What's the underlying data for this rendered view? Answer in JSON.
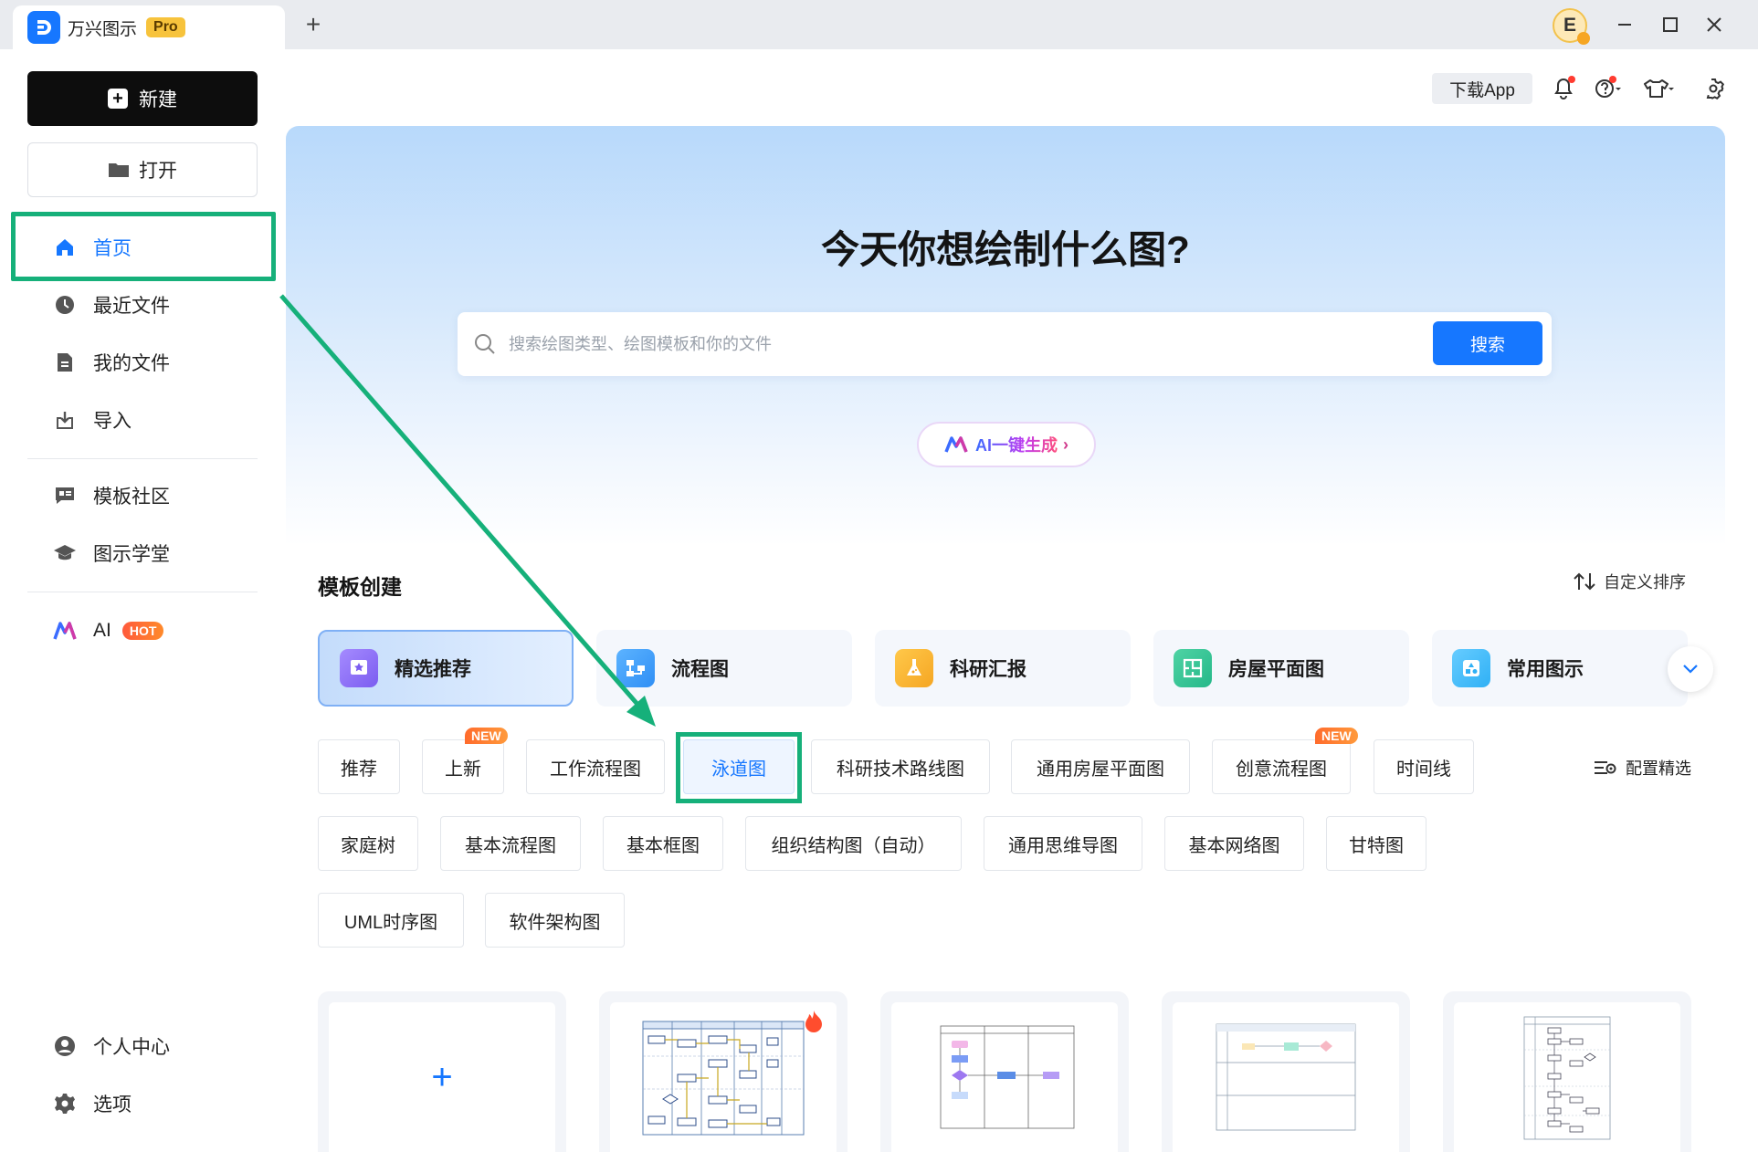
{
  "titlebar": {
    "app_name": "万兴图示",
    "pro_badge": "Pro",
    "new_tab": "+",
    "user_initial": "E"
  },
  "sidebar": {
    "new_label": "新建",
    "open_label": "打开",
    "items": [
      {
        "label": "首页",
        "icon": "home-icon",
        "active": true
      },
      {
        "label": "最近文件",
        "icon": "clock-icon"
      },
      {
        "label": "我的文件",
        "icon": "file-icon"
      },
      {
        "label": "导入",
        "icon": "import-icon"
      },
      {
        "label": "模板社区",
        "icon": "community-icon"
      },
      {
        "label": "图示学堂",
        "icon": "graduation-cap-icon"
      },
      {
        "label": "AI",
        "icon": "ai-logo-icon",
        "badge": "HOT"
      },
      {
        "label": "个人中心",
        "icon": "user-icon"
      },
      {
        "label": "选项",
        "icon": "gear-icon"
      }
    ]
  },
  "toolbar": {
    "download_app": "下载App"
  },
  "hero": {
    "title": "今天你想绘制什么图?",
    "search_placeholder": "搜索绘图类型、绘图模板和你的文件",
    "search_button": "搜索",
    "ai_button": "AI一键生成",
    "ai_chevron": "›"
  },
  "templates": {
    "section_title": "模板创建",
    "sort_label": "自定义排序",
    "config_label": "配置精选",
    "categories": [
      {
        "label": "精选推荐",
        "color": "#8b6cf0",
        "selected": true
      },
      {
        "label": "流程图",
        "color": "#2f8ff5"
      },
      {
        "label": "科研汇报",
        "color": "#f5a623"
      },
      {
        "label": "房屋平面图",
        "color": "#25b889"
      },
      {
        "label": "常用图示",
        "color": "#2fb0f5"
      }
    ],
    "chips": [
      {
        "label": "推荐"
      },
      {
        "label": "上新",
        "badge": "NEW"
      },
      {
        "label": "工作流程图"
      },
      {
        "label": "泳道图",
        "selected": true
      },
      {
        "label": "科研技术路线图"
      },
      {
        "label": "通用房屋平面图"
      },
      {
        "label": "创意流程图",
        "badge": "NEW"
      },
      {
        "label": "时间线"
      },
      {
        "label": "家庭树"
      },
      {
        "label": "基本流程图"
      },
      {
        "label": "基本框图"
      },
      {
        "label": "组织结构图（自动）"
      },
      {
        "label": "通用思维导图"
      },
      {
        "label": "基本网络图"
      },
      {
        "label": "甘特图"
      },
      {
        "label": "UML时序图"
      },
      {
        "label": "软件架构图"
      }
    ],
    "blank_card_symbol": "+"
  },
  "colors": {
    "accent": "#1677ff",
    "annotation": "#16b07a"
  }
}
